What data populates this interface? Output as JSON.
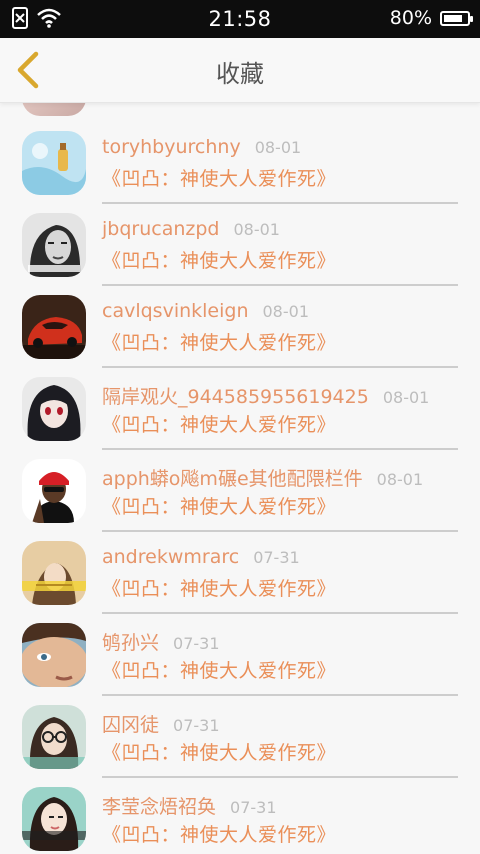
{
  "status_bar": {
    "time": "21:58",
    "battery": "80%",
    "battery_level": 0.8
  },
  "header": {
    "title": "收藏"
  },
  "colors": {
    "accent": "#e6956a",
    "back_arrow": "#d9a82e"
  },
  "favorites": [
    {
      "name": "toryhbyurchny",
      "date": "08-01",
      "subtitle": "《凹凸：神使大人爱作死》",
      "avatar": "cyan-bottle"
    },
    {
      "name": "jbqrucanzpd",
      "date": "08-01",
      "subtitle": "《凹凸：神使大人爱作死》",
      "avatar": "bw-woman"
    },
    {
      "name": "cavlqsvinkleign",
      "date": "08-01",
      "subtitle": "《凹凸：神使大人爱作死》",
      "avatar": "red-car"
    },
    {
      "name": "隔岸观火_944585955619425",
      "date": "08-01",
      "subtitle": "《凹凸：神使大人爱作死》",
      "avatar": "anime-girl"
    },
    {
      "name": "apph蟒o飚m碾e其他配隈栏件",
      "date": "08-01",
      "subtitle": "《凹凸：神使大人爱作死》",
      "avatar": "red-cap"
    },
    {
      "name": "andrekwmrarc",
      "date": "07-31",
      "subtitle": "《凹凸：神使大人爱作死》",
      "avatar": "yellow-girl"
    },
    {
      "name": "鸲孙兴",
      "date": "07-31",
      "subtitle": "《凹凸：神使大人爱作死》",
      "avatar": "face-closeup"
    },
    {
      "name": "囚冈徒",
      "date": "07-31",
      "subtitle": "《凹凸：神使大人爱作死》",
      "avatar": "glasses-girl"
    },
    {
      "name": "李莹念焐祒奂",
      "date": "07-31",
      "subtitle": "《凹凸：神使大人爱作死》",
      "avatar": "girl-teal"
    }
  ]
}
